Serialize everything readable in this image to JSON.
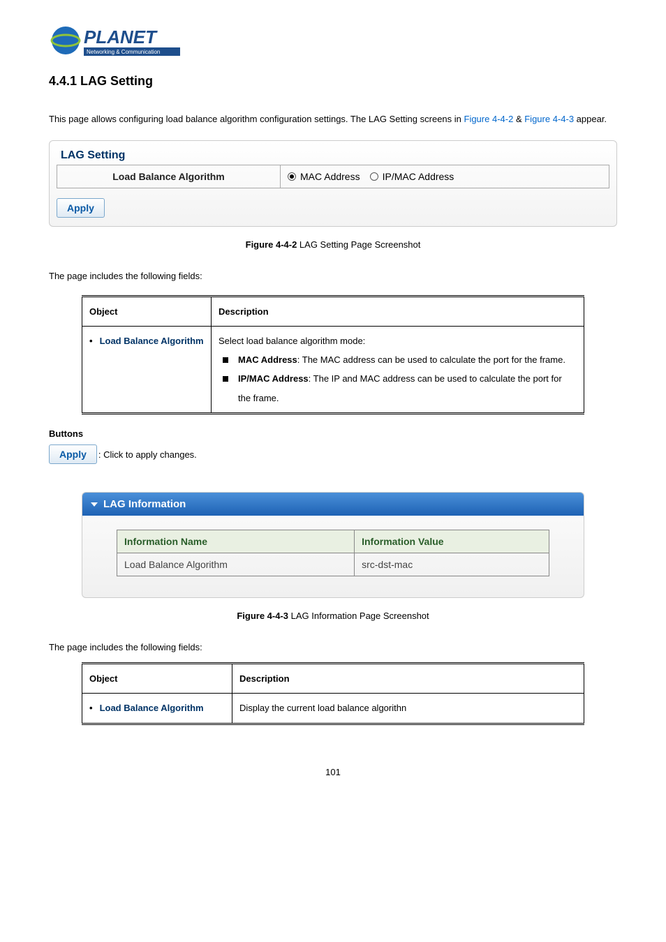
{
  "logo": {
    "name": "PLANET",
    "tagline": "Networking & Communication"
  },
  "heading": "4.4.1 LAG Setting",
  "intro": {
    "pre": "This page allows configuring load balance algorithm configuration settings. The LAG Setting screens in ",
    "link1": "Figure 4-4-2",
    "mid": " & ",
    "link2": "Figure 4-4-3",
    "post": " appear."
  },
  "panel": {
    "title": "LAG Setting",
    "label": "Load Balance Algorithm",
    "opt1": "MAC Address",
    "opt2": "IP/MAC Address",
    "apply": "Apply"
  },
  "fig1": {
    "bold": "Figure 4-4-2",
    "rest": " LAG Setting Page Screenshot"
  },
  "fields_intro": "The page includes the following fields:",
  "table1": {
    "h1": "Object",
    "h2": "Description",
    "obj": "Load Balance Algorithm",
    "desc_top": "Select load balance algorithm mode:",
    "b1_bold": "MAC Address",
    "b1_rest": ": The MAC address can be used to calculate the port for the frame.",
    "b2_bold": "IP/MAC Address",
    "b2_rest": ": The IP and MAC address can be used to calculate the port for the frame."
  },
  "buttons": {
    "title": "Buttons",
    "apply": "Apply",
    "desc": ": Click to apply changes."
  },
  "info": {
    "title": "LAG Information",
    "h1": "Information Name",
    "h2": "Information Value",
    "r1c1": "Load Balance Algorithm",
    "r1c2": "src-dst-mac"
  },
  "fig2": {
    "bold": "Figure 4-4-3",
    "rest": " LAG Information Page Screenshot"
  },
  "table2": {
    "h1": "Object",
    "h2": "Description",
    "obj": "Load Balance Algorithm",
    "desc": "Display the current load balance algorithn"
  },
  "page_number": "101",
  "chart_data": {
    "type": "table",
    "tables": [
      {
        "title": "LAG Setting Fields",
        "columns": [
          "Object",
          "Description"
        ],
        "rows": [
          [
            "Load Balance Algorithm",
            "Select load balance algorithm mode: MAC Address — The MAC address can be used to calculate the port for the frame. IP/MAC Address — The IP and MAC address can be used to calculate the port for the frame."
          ]
        ]
      },
      {
        "title": "LAG Information",
        "columns": [
          "Information Name",
          "Information Value"
        ],
        "rows": [
          [
            "Load Balance Algorithm",
            "src-dst-mac"
          ]
        ]
      },
      {
        "title": "LAG Information Fields",
        "columns": [
          "Object",
          "Description"
        ],
        "rows": [
          [
            "Load Balance Algorithm",
            "Display the current load balance algorithn"
          ]
        ]
      }
    ]
  }
}
